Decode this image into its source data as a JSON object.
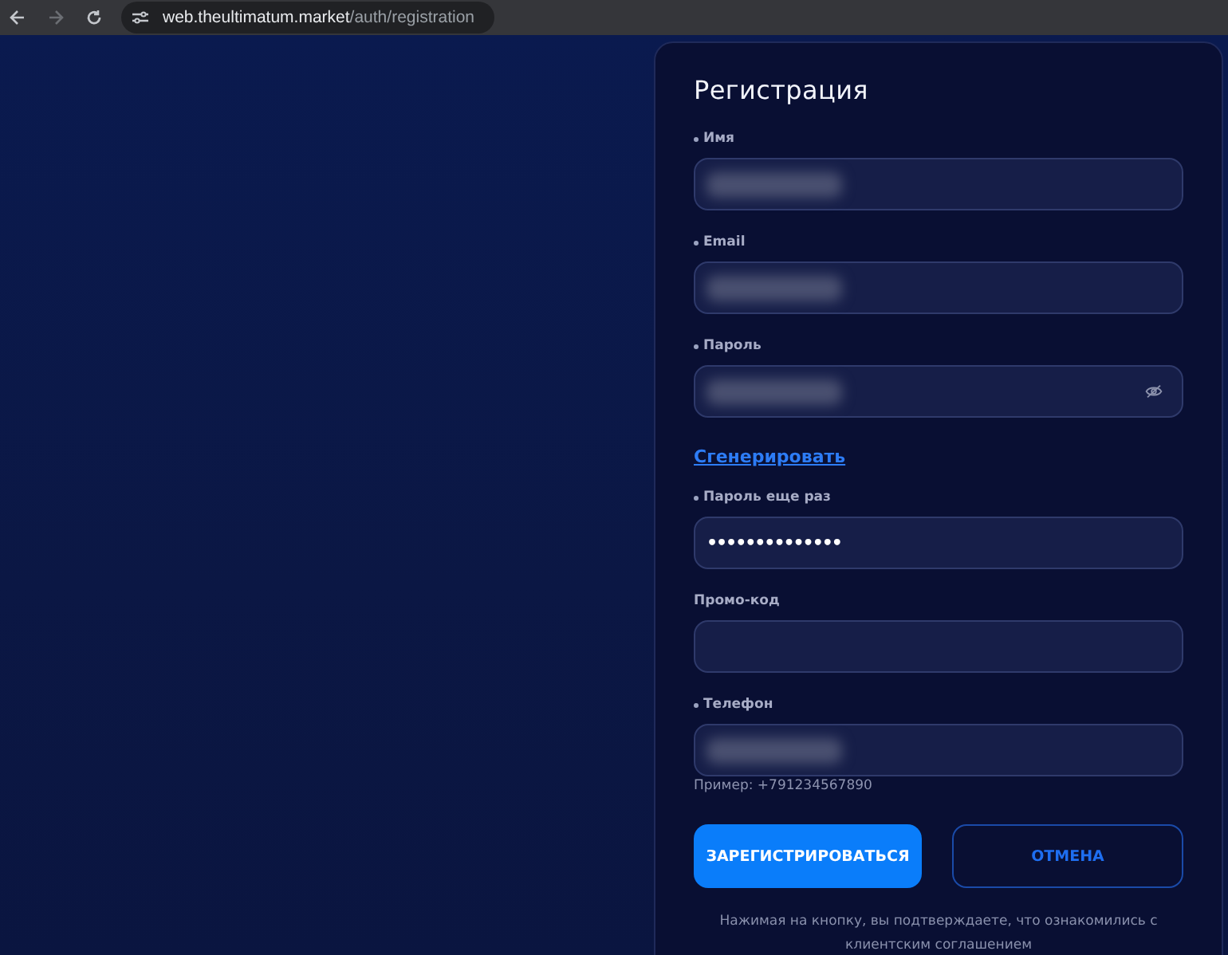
{
  "browser": {
    "url_host": "web.theultimatum.market",
    "url_path": "/auth/registration"
  },
  "form": {
    "title": "Регистрация",
    "items": [
      {
        "kind": "field",
        "label": "Имя",
        "required": true,
        "redacted": true,
        "eye": false
      },
      {
        "kind": "field",
        "label": "Email",
        "required": true,
        "redacted": true,
        "eye": false
      },
      {
        "kind": "field",
        "label": "Пароль",
        "required": true,
        "redacted": true,
        "eye": true
      },
      {
        "kind": "link",
        "text": "Сгенерировать"
      },
      {
        "kind": "field",
        "label": "Пароль еще раз",
        "required": true,
        "redacted": false,
        "value": "••••••••••••••",
        "eye": false
      },
      {
        "kind": "field",
        "label": "Промо-код",
        "required": false,
        "redacted": false,
        "eye": false
      },
      {
        "kind": "field",
        "label": "Телефон",
        "required": true,
        "redacted": true,
        "eye": false,
        "hint": "Пример: +791234567890"
      }
    ],
    "buttons": [
      {
        "kind": "primary",
        "label": "ЗАРЕГИСТРИРОВАТЬСЯ"
      },
      {
        "kind": "outline",
        "label": "ОТМЕНА"
      }
    ],
    "note": "Нажимая на кнопку, вы подтверждаете, что ознакомились с клиентским соглашением"
  }
}
